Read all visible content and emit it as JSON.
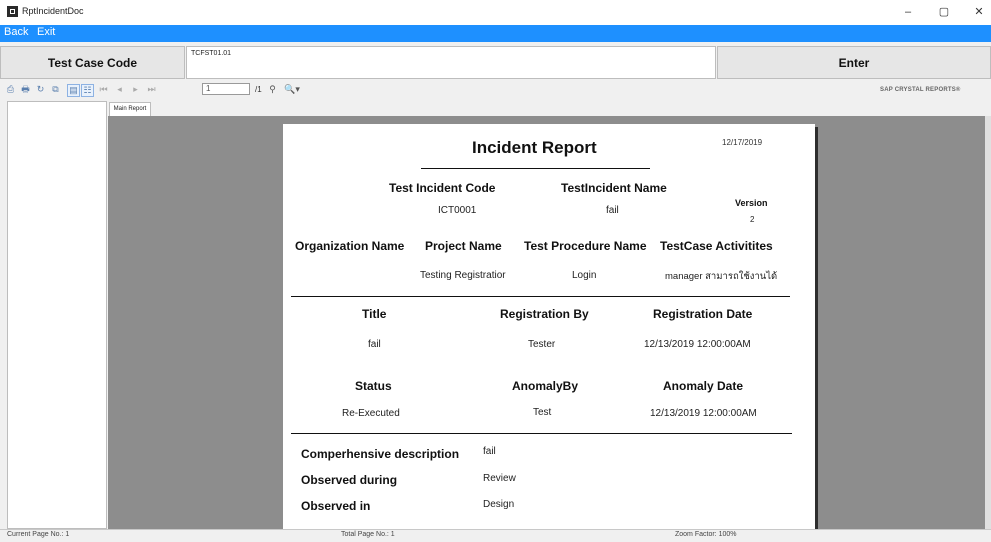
{
  "window": {
    "title": "RptIncidentDoc",
    "min_glyph": "–",
    "max_glyph": "▢",
    "close_glyph": "✕"
  },
  "menu": {
    "back": "Back",
    "exit": "Exit"
  },
  "test_case": {
    "label": "Test Case Code",
    "value": "TCFST01.01",
    "enter_label": "Enter"
  },
  "viewer": {
    "page_input": "1",
    "page_total": "/1",
    "brand": "SAP CRYSTAL REPORTS®",
    "tab_main": "Main Report",
    "icons": [
      "export-icon",
      "print-icon",
      "refresh-icon",
      "copy-icon",
      "toggle-group-tree-icon",
      "toggle-parameter-icon",
      "first-page-icon",
      "prev-page-icon",
      "next-page-icon",
      "last-page-icon",
      "find-icon",
      "zoom-icon"
    ]
  },
  "report": {
    "title": "Incident Report",
    "date": "12/17/2019",
    "h_incident_code": "Test Incident Code",
    "h_incident_name": "TestIncident Name",
    "h_version": "Version",
    "incident_code": "ICT0001",
    "incident_name": "fail",
    "version": "2",
    "h_org": "Organization Name",
    "h_project": "Project Name",
    "h_procedure": "Test Procedure Name",
    "h_activities": "TestCase Activitites",
    "project": "Testing Registratior",
    "procedure": "Login",
    "activities": "manager สามารถใช้งานได้",
    "h_title": "Title",
    "h_reg_by": "Registration By",
    "h_reg_date": "Registration Date",
    "title_val": "fail",
    "reg_by": "Tester",
    "reg_date": "12/13/2019  12:00:00AM",
    "h_status": "Status",
    "h_anomaly_by": "AnomalyBy",
    "h_anomaly_date": "Anomaly Date",
    "status": "Re-Executed",
    "anomaly_by": "Test",
    "anomaly_date": "12/13/2019  12:00:00AM",
    "h_comp_desc": "Comperhensive description",
    "comp_desc": "fail",
    "h_observed_during": "Observed during",
    "observed_during": "Review",
    "h_observed_in": "Observed in",
    "observed_in": "Design"
  },
  "status_bar": {
    "current_page": "Current Page No.: 1",
    "total_page": "Total Page No.: 1",
    "zoom": "Zoom Factor: 100%"
  }
}
